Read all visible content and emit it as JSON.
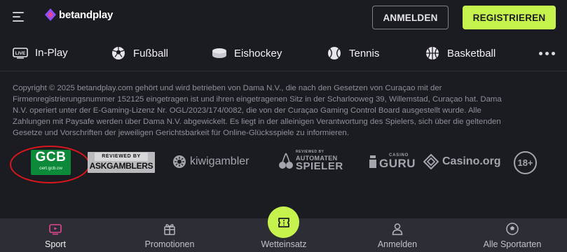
{
  "header": {
    "logo_text": "betandplay",
    "login_label": "ANMELDEN",
    "register_label": "REGISTRIEREN"
  },
  "sports_nav": {
    "items": [
      {
        "label": "In-Play",
        "icon": "live-icon"
      },
      {
        "label": "Fußball",
        "icon": "soccer-ball-icon"
      },
      {
        "label": "Eishockey",
        "icon": "hockey-puck-icon"
      },
      {
        "label": "Tennis",
        "icon": "tennis-ball-icon"
      },
      {
        "label": "Basketball",
        "icon": "basketball-icon"
      }
    ],
    "live_badge": "LIVE"
  },
  "copyright": "Copyright © 2025 betandplay.com gehört und wird betrieben von Dama N.V., die nach den Gesetzen von Curaçao mit der Firmenregistrierungsnummer 152125 eingetragen ist und ihren eingetragenen Sitz in der Scharlooweg 39, Willemstad, Curaçao hat. Dama N.V. operiert unter der E-Gaming-Lizenz Nr. OGL/2023/174/0082, die von der Curaçao Gaming Control Board ausgestellt wurde. Alle Zahlungen mit Paysafe werden über Dama N.V. abgewickelt. Es liegt in der alleinigen Verantwortung des Spielers, sich über die geltenden Gesetze und Vorschriften der jeweiligen Gerichtsbarkeit für Online-Glücksspiele zu informieren.",
  "partners": {
    "gcb": {
      "title": "GCB",
      "subtitle": "cert.gcb.cw"
    },
    "askgamblers": {
      "line1": "REVIEWED BY",
      "line2": "ASKGAMBLERS"
    },
    "kiwigambler": "kiwigambler",
    "automaten": {
      "line1": "REVIEWED BY",
      "line2": "AUTOMATEN",
      "line3": "SPIELER"
    },
    "casino_guru": {
      "line1": "CASINO",
      "line2": "GURU"
    },
    "casino_org": "Casino.org",
    "age_limit": "18+"
  },
  "bottom_nav": {
    "tabs": [
      {
        "label": "Sport",
        "icon": "tv-icon",
        "active": true
      },
      {
        "label": "Promotionen",
        "icon": "gift-icon",
        "active": false
      },
      {
        "label": "Wetteinsatz",
        "icon": "ticket-icon",
        "active": false
      },
      {
        "label": "Anmelden",
        "icon": "user-icon",
        "active": false
      },
      {
        "label": "Alle Sportarten",
        "icon": "soccer-ball-icon",
        "active": false
      }
    ]
  },
  "colors": {
    "background": "#1b1c22",
    "accent": "#c6f24e",
    "active_tab_icon": "#e0478f",
    "logo_purple": "#8a4dff",
    "gcb_green": "#0c8a3a",
    "annotation_red": "#d8161b"
  }
}
